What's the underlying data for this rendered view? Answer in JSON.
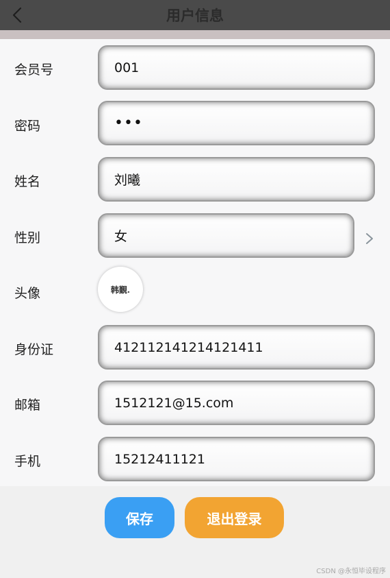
{
  "header": {
    "title": "用户信息",
    "back_icon": "chevron-left-icon"
  },
  "form": {
    "member_no": {
      "label": "会员号",
      "value": "001"
    },
    "password": {
      "label": "密码",
      "value": "•••"
    },
    "name": {
      "label": "姓名",
      "value": "刘曦"
    },
    "gender": {
      "label": "性别",
      "value": "女",
      "icon": "chevron-right-icon"
    },
    "avatar": {
      "label": "头像",
      "text": "韩覲."
    },
    "id_card": {
      "label": "身份证",
      "value": "412112141214121411"
    },
    "email": {
      "label": "邮箱",
      "value": "1512121@15.com"
    },
    "phone": {
      "label": "手机",
      "value": "15212411121"
    }
  },
  "actions": {
    "save_label": "保存",
    "logout_label": "退出登录"
  },
  "watermark": "CSDN @永恒毕设程序",
  "colors": {
    "header_bg": "#4a4a4a",
    "save_button": "#3a9ff3",
    "logout_button": "#f2a432"
  }
}
